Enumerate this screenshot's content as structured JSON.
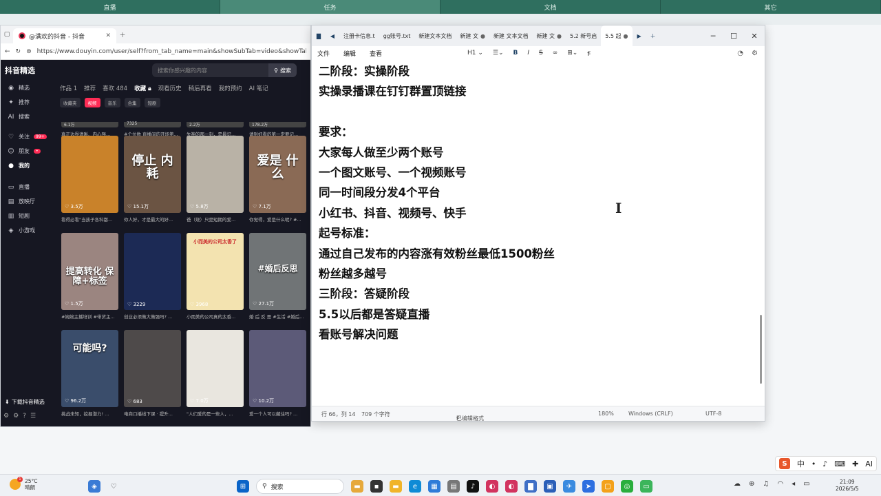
{
  "top_tabs": [
    "直播",
    "任务",
    "文档",
    "其它"
  ],
  "browser": {
    "tab_title": "@满欢的抖音 - 抖音",
    "url": "https://www.douyin.com/user/self?from_tab_name=main&showSubTab=video&showTab=favo"
  },
  "douyin": {
    "logo": "抖音精选",
    "search_placeholder": "搜索你感兴趣的内容",
    "search_button": "搜索",
    "side_items": [
      {
        "icon": "◉",
        "label": "精选"
      },
      {
        "icon": "✦",
        "label": "推荐"
      },
      {
        "icon": "AI",
        "label": "搜索"
      },
      {
        "icon": "♡",
        "label": "关注",
        "badge": "99+"
      },
      {
        "icon": "☺",
        "label": "朋友",
        "badge": "•"
      },
      {
        "icon": "●",
        "label": "我的"
      },
      {
        "icon": "▭",
        "label": "直播"
      },
      {
        "icon": "▤",
        "label": "放映厅"
      },
      {
        "icon": "▥",
        "label": "短剧"
      },
      {
        "icon": "◈",
        "label": "小游戏"
      }
    ],
    "download_label": "下载抖音精选",
    "profile_tabs": [
      "作品 1",
      "推荐",
      "喜欢 484",
      "收藏",
      "观看历史",
      "稍后再看",
      "我的预约",
      "AI 笔记"
    ],
    "chips": [
      "收藏夹",
      "视频",
      "音乐",
      "合集",
      "短剧"
    ],
    "top_row": [
      {
        "likes": "6.1万",
        "caption": "真正边界清晰、内心强..."
      },
      {
        "likes": "7325",
        "caption": "#个位数 直播间的开场第..."
      },
      {
        "likes": "2.2万",
        "caption": "失神的那一刻，是最识..."
      },
      {
        "likes": "178.2万",
        "caption": "请别好看的第一定要记..."
      }
    ],
    "videos": [
      {
        "likes": "3.5万",
        "caption": "看得必看\"当孩子各科都...",
        "overlay": "",
        "bg": "#c9822a"
      },
      {
        "likes": "15.1万",
        "caption": "你人好，才是最大的好...",
        "overlay": "停止 内耗",
        "bg": "#6b5443"
      },
      {
        "likes": "5.8万",
        "caption": "爸（烧）只是短期的爱...",
        "overlay": "",
        "bg": "#b9b2a6"
      },
      {
        "likes": "7.1万",
        "caption": "你觉得，爱是什么呢? #...",
        "overlay": "爱是 什么",
        "bg": "#8a6a55"
      },
      {
        "likes": "1.5万",
        "caption": "#婉婉主播培训 #带货主...",
        "overlay": "提高转化 保障+标签",
        "bg": "#9b8580"
      },
      {
        "likes": "3229",
        "caption": "创业必须做大做强吗? ...",
        "overlay": "",
        "bg": "#1c2a55"
      },
      {
        "likes": "3968",
        "caption": "小而美的公司真的太香...",
        "overlay": "小而美的公司太香了",
        "bg": "#f3e3b0"
      },
      {
        "likes": "27.1万",
        "caption": "婚 后 反 思 #生活 #婚后...",
        "overlay": "#婚后反思",
        "bg": "#707476"
      },
      {
        "likes": "96.2万",
        "caption": "挑战未知，挖掘潜力! ...",
        "overlay": "可能吗?",
        "bg": "#3a4d6b"
      },
      {
        "likes": "683",
        "caption": "电商口播线下课 · 提升...",
        "overlay": "",
        "bg": "#4e4a4a"
      },
      {
        "likes": "7.0万",
        "caption": "\"人们爱的是一些人，...",
        "overlay": "",
        "bg": "#e9e6df"
      },
      {
        "likes": "10.2万",
        "caption": "爱一个人可以藏住吗? ...",
        "overlay": "",
        "bg": "#5c5a78"
      }
    ]
  },
  "notepad": {
    "tabs": [
      "注册卡信息.t",
      "gg账号.txt",
      "新建文本文档",
      "新建 文",
      "新建 文本文档",
      "新建 文",
      "5.2 新号启",
      "5.5 起"
    ],
    "menu": [
      "文件",
      "编辑",
      "查看"
    ],
    "heading_level": "H1",
    "lines": [
      "二阶段：实操阶段",
      "实操录播课在钉钉群置顶链接",
      "",
      "要求：",
      "大家每人做至少两个账号",
      "一个图文账号、一个视频账号",
      "同一时间段分发4个平台",
      "小红书、抖音、视频号、快手",
      "起号标准：",
      "通过自己发布的内容涨有效粉丝最低1500粉丝",
      "粉丝越多越号",
      "三阶段：答疑阶段",
      "5.5以后都是答疑直播",
      "看账号解决问题"
    ],
    "status": {
      "position": "行 66，列 14",
      "chars": "709 个字符",
      "format": "已编辑格式",
      "zoom": "180%",
      "line_ending": "Windows (CRLF)",
      "encoding": "UTF-8"
    }
  },
  "ime": {
    "logo": "S",
    "items": [
      "中",
      "•",
      "♪",
      "⌨",
      "✚",
      "AI"
    ]
  },
  "taskbar": {
    "temperature": "25°C",
    "weather": "晴朗",
    "search_label": "搜索",
    "time": "21:09",
    "date": "2026/5/5"
  }
}
